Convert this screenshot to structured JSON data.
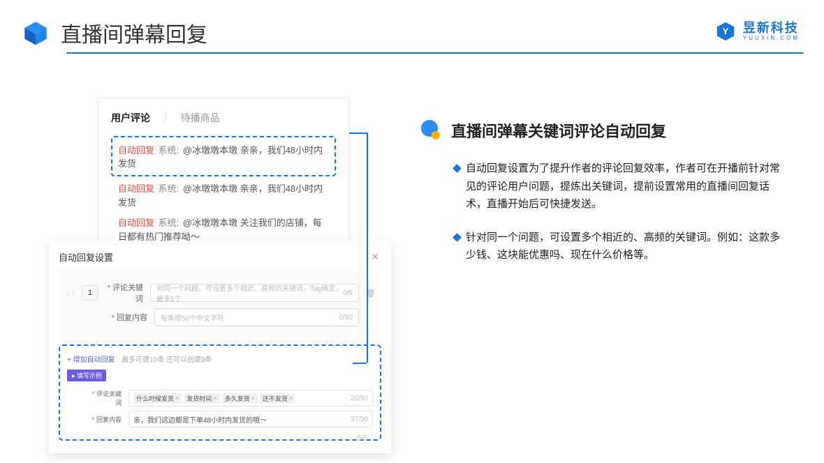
{
  "header": {
    "title": "直播间弹幕回复"
  },
  "brand": {
    "cn": "昱新科技",
    "en": "YUUXIN.COM"
  },
  "comments": {
    "tab_active": "用户评论",
    "tab_other": "待播商品",
    "auto_label": "自动回复",
    "sys_label": "系统:",
    "row1": "@冰墩墩本墩 亲亲，我们48小时内发货",
    "row2": "@冰墩墩本墩 亲亲，我们48小时内发货",
    "row3": "@冰墩墩本墩 关注我们的店铺，每日都有热门推荐呦～"
  },
  "settings": {
    "title": "自动回复设置",
    "seq": "1",
    "kw_label": "评论关键词",
    "kw_placeholder": "对同一个问题，可设置多个相近、高频的关键词，Tag确定，最多5个",
    "kw_counter": "0/5",
    "content_label": "回复内容",
    "content_placeholder": "每条限50个中文字符",
    "content_counter": "0/50",
    "add_link": "+ 增加自动回复",
    "add_hint": "最多可建10条 还可以创建9条",
    "badge": "● 填写示例",
    "ex_kw_label": "评论关键词",
    "ex_kw_tags": [
      "什么时候发货",
      "发货时间",
      "多久发货",
      "还不发货"
    ],
    "ex_kw_counter": "20/50",
    "ex_ct_label": "回复内容",
    "ex_ct_value": "亲，我们这边都是下单48小时内发货的哦～",
    "ex_ct_counter": "37/50",
    "ghost_counter": "/50"
  },
  "right": {
    "section_title": "直播间弹幕关键词评论自动回复",
    "b1": "自动回复设置为了提升作者的评论回复效率，作者可在开播前针对常见的评论用户问题，提炼出关键词，提前设置常用的直播间回复话术，直播开始后可快捷发送。",
    "b2": "针对同一个问题，可设置多个相近的、高频的关键词。例如：这款多少钱、这块能优惠吗、现在什么价格等。"
  }
}
